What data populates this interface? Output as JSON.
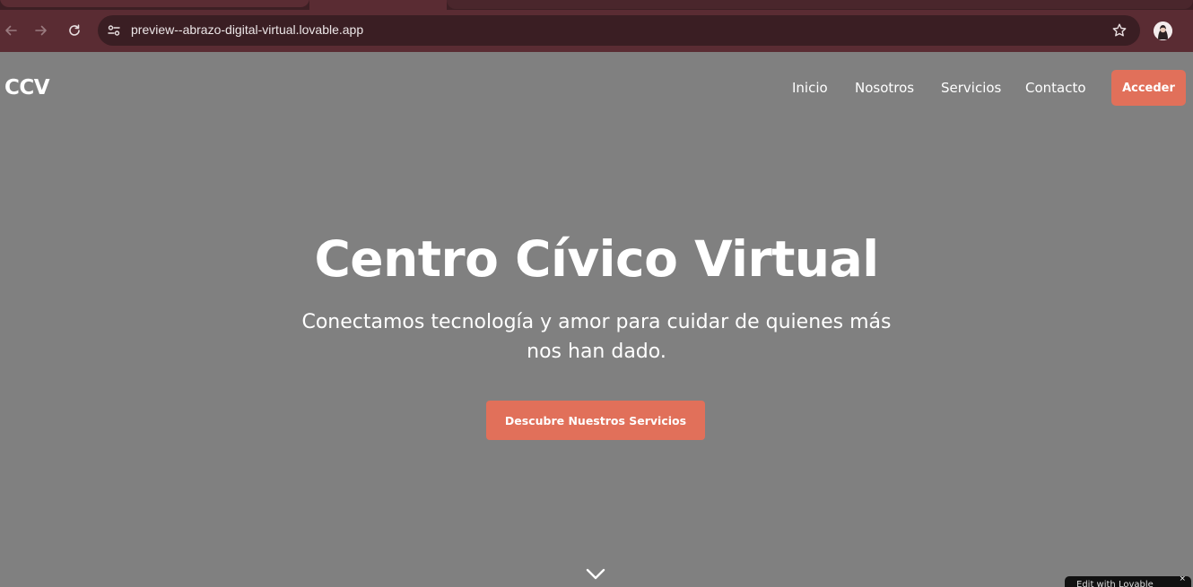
{
  "browser": {
    "url": "preview--abrazo-digital-virtual.lovable.app",
    "icons": {
      "back": "arrow-left-icon",
      "forward": "arrow-right-icon",
      "reload": "reload-icon",
      "site_info": "tune-icon",
      "bookmark": "star-icon",
      "profile": "avatar"
    }
  },
  "site": {
    "logo": "CCV",
    "nav": {
      "links": [
        "Inicio",
        "Nosotros",
        "Servicios",
        "Contacto"
      ],
      "cta": "Acceder"
    },
    "hero": {
      "title": "Centro Cívico Virtual",
      "subtitle": "Conectamos tecnología y amor para cuidar de quienes más nos han dado.",
      "cta": "Descubre Nuestros Servicios"
    },
    "scroll_icon": "chevron-down-icon",
    "edit_badge": {
      "label": "Edit with Lovable",
      "close": "×"
    }
  },
  "colors": {
    "chrome_toolbar": "#5a2c33",
    "omnibox": "#3a1e23",
    "page_background": "#808080",
    "accent": "#e1705a",
    "text": "#ffffff"
  }
}
